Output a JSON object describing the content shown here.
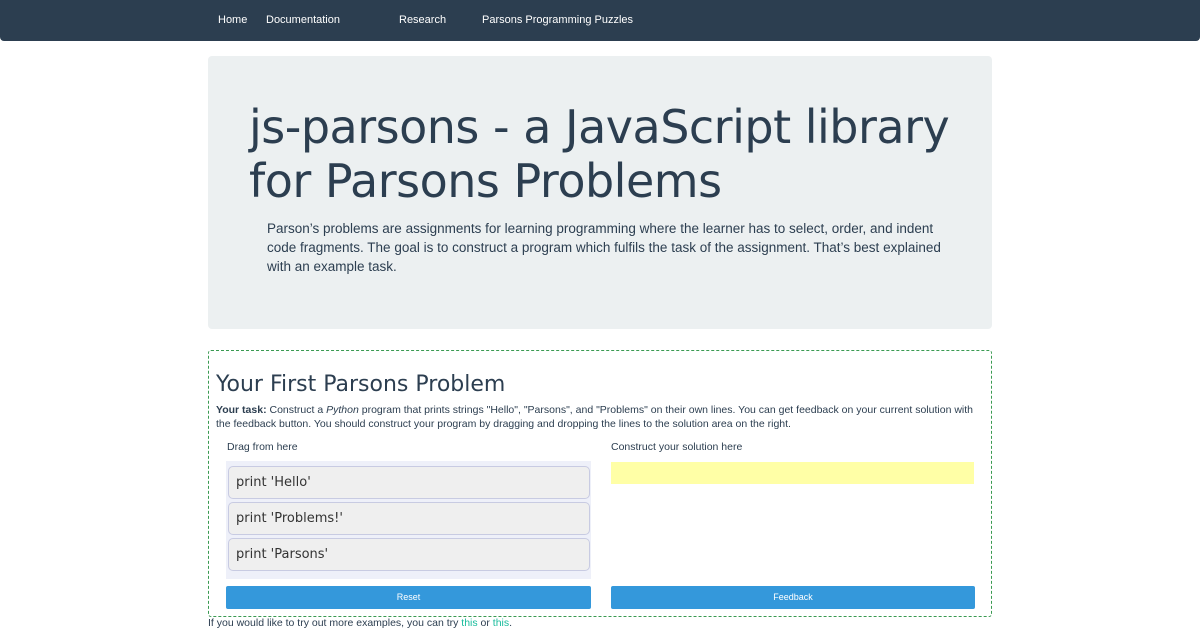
{
  "nav": {
    "items": [
      {
        "label": "Home"
      },
      {
        "label": "Documentation"
      },
      {
        "label": "Research"
      },
      {
        "label": "Parsons Programming Puzzles"
      }
    ]
  },
  "hero": {
    "title": "js-parsons - a JavaScript library for Parsons Problems",
    "lead": "Parson’s problems are assignments for learning programming where the learner has to select, order, and indent code fragments. The goal is to construct a program which fulfils the task of the assignment. That’s best explained with an example task."
  },
  "problem": {
    "title": "Your First Parsons Problem",
    "task_label": "Your task:",
    "task_text_1": " Construct a ",
    "task_language": "Python",
    "task_text_2": " program that prints strings \"Hello\", \"Parsons\", and \"Problems\" on their own lines. You can get feedback on your current solution with the feedback button. You should construct your program by dragging and dropping the lines to the solution area on the right.",
    "source_label": "Drag from here",
    "solution_label": "Construct your solution here",
    "code_lines": [
      "print 'Hello'",
      "print 'Problems!'",
      "print 'Parsons'"
    ],
    "reset_label": "Reset",
    "feedback_label": "Feedback"
  },
  "footer": {
    "text_1": "If you would like to try out more examples, you can try ",
    "link_1": "this",
    "text_2": " or ",
    "link_2": "this",
    "text_3": "."
  },
  "colors": {
    "navbar": "#2c3e50",
    "jumbotron": "#ecf0f1",
    "button": "#3498db",
    "link": "#18bc9c",
    "solution_area": "#ffffa6",
    "source_area": "#eef0f9",
    "problem_border": "#3a9a52"
  }
}
